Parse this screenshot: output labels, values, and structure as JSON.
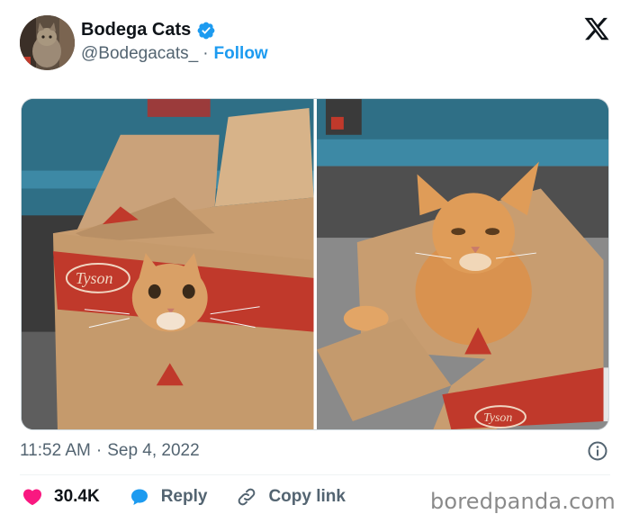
{
  "author": {
    "display_name": "Bodega Cats",
    "handle": "@Bodegacats_",
    "separator": "·",
    "follow_label": "Follow",
    "verified_color": "#1d9bf0"
  },
  "timestamp": {
    "time": "11:52 AM",
    "separator": "·",
    "date": "Sep 4, 2022"
  },
  "actions": {
    "like_count": "30.4K",
    "like_color": "#f91880",
    "reply_label": "Reply",
    "copy_label": "Copy link"
  },
  "watermark": "boredpanda.com",
  "icons": {
    "close": "x-logo-icon",
    "info": "info-icon",
    "like": "heart-icon",
    "reply": "speech-bubble-icon",
    "copy": "link-icon"
  }
}
